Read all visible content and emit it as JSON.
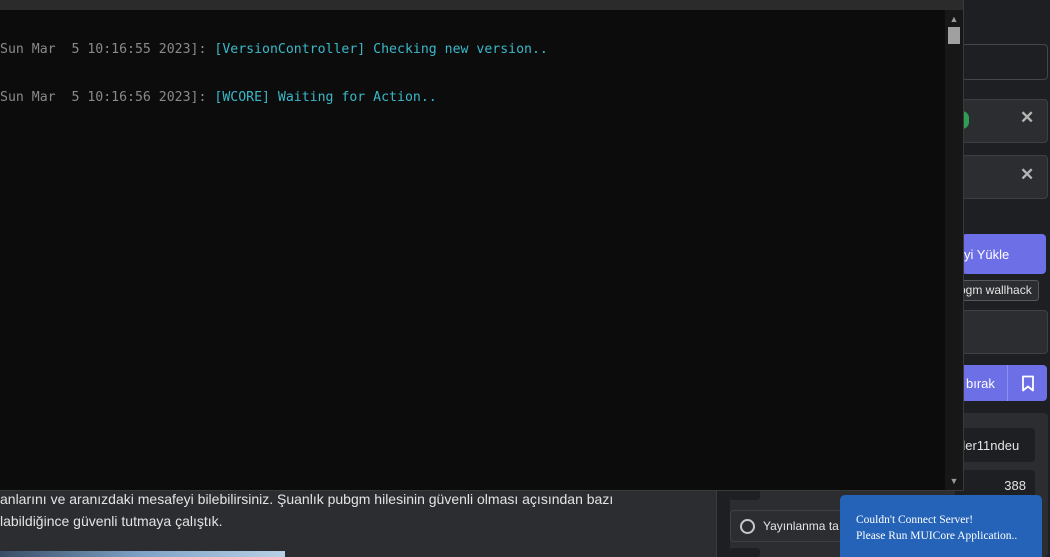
{
  "console": {
    "lines": [
      {
        "timestamp": "Sun Mar  5 10:16:55 2023]:",
        "message": "[VersionController] Checking new version.."
      },
      {
        "timestamp": "Sun Mar  5 10:16:56 2023]:",
        "message": "[WCORE] Waiting for Action.."
      }
    ],
    "scroll_up_glyph": "▲",
    "scroll_down_glyph": "▼",
    "colors": {
      "background": "#0c0c0c",
      "timestamp": "#8a8a8a",
      "message": "#3ab8c9"
    }
  },
  "article": {
    "line1": "anlarını ve aranızdaki mesafeyi bilebilirsiniz. Şuanlık pubgm hilesinin güvenli olması açısından bazı",
    "line2": "labildiğince güvenli tutmaya çalıştık."
  },
  "sidebar": {
    "close_glyph": "✕",
    "upload_button_label": "yi Yükle",
    "tag_label": "bgm wallhack",
    "save_button_label": "bırak",
    "bookmark_icon": "bookmark-icon",
    "username": "der11ndeu",
    "count": "388",
    "publish_label": "Yayınlanma ta",
    "accent_color": "#6c6fe6"
  },
  "toast": {
    "line1": "Couldn't Connect Server!",
    "line2": "Please Run MUICore Application..",
    "color": "#2463b8"
  }
}
